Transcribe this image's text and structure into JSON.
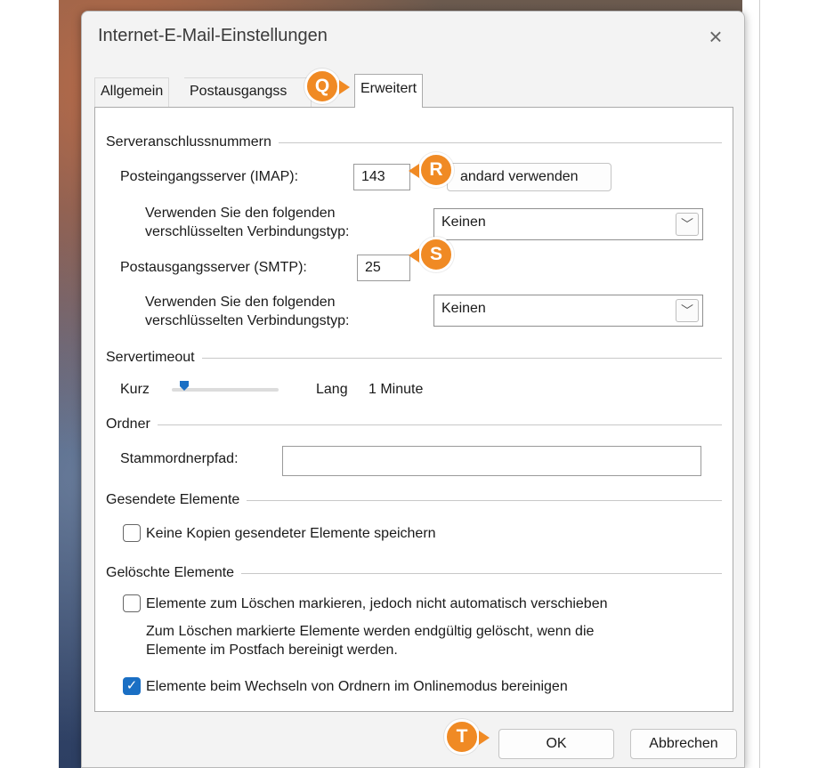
{
  "window": {
    "title": "Internet-E-Mail-Einstellungen",
    "close_symbol": "×"
  },
  "tabs": [
    {
      "label": "Allgemein"
    },
    {
      "label": "Postausgangss"
    },
    {
      "label": "Erweitert"
    }
  ],
  "server_ports": {
    "group_title": "Serveranschlussnummern",
    "imap_label": "Posteingangsserver (IMAP):",
    "imap_value": "143",
    "default_button": "andard verwenden",
    "encryption_label_1_line1": "Verwenden Sie den folgenden",
    "encryption_label_1_line2": "verschlüsselten Verbindungstyp:",
    "encryption_value_1": "Keinen",
    "smtp_label": "Postausgangsserver (SMTP):",
    "smtp_value": "25",
    "encryption_label_2_line1": "Verwenden Sie den folgenden",
    "encryption_label_2_line2": "verschlüsselten Verbindungstyp:",
    "encryption_value_2": "Keinen"
  },
  "timeout": {
    "group_title": "Servertimeout",
    "short_label": "Kurz",
    "long_label": "Lang",
    "value_label": "1 Minute",
    "slider_fraction": 0.1
  },
  "folders": {
    "group_title": "Ordner",
    "root_label": "Stammordnerpfad:",
    "root_value": ""
  },
  "sent_items": {
    "group_title": "Gesendete Elemente",
    "no_copies_label": "Keine Kopien gesendeter Elemente speichern",
    "no_copies_checked": false
  },
  "deleted_items": {
    "group_title": "Gelöschte Elemente",
    "mark_label": "Elemente zum Löschen markieren, jedoch nicht automatisch verschieben",
    "mark_checked": false,
    "info_line1": "Zum Löschen markierte Elemente werden endgültig gelöscht, wenn die",
    "info_line2": "Elemente im Postfach bereinigt werden.",
    "purge_label": "Elemente beim Wechseln von Ordnern im Onlinemodus bereinigen",
    "purge_checked": true
  },
  "footer": {
    "ok_label": "OK",
    "cancel_label": "Abbrechen"
  },
  "annotations": {
    "q": "Q",
    "r": "R",
    "s": "S",
    "t": "T"
  },
  "colors": {
    "accent": "#1a6fc4",
    "badge": "#f08a24"
  }
}
